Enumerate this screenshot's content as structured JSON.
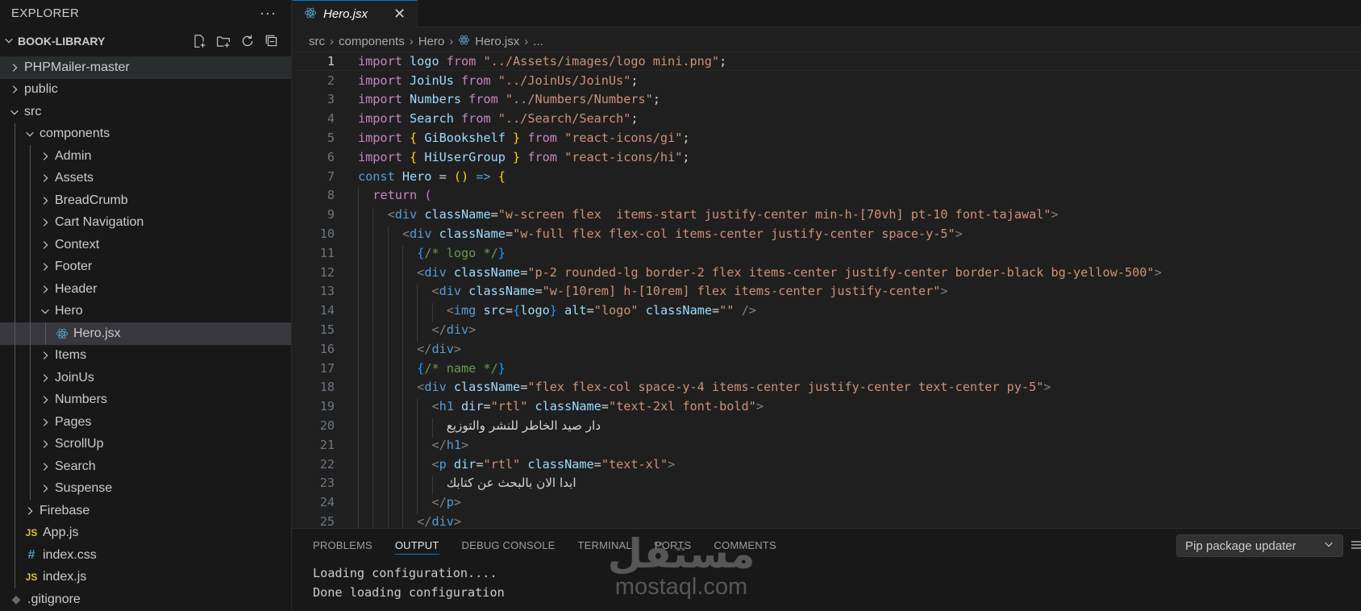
{
  "explorer": {
    "title": "EXPLORER",
    "more": "···",
    "project": "BOOK-LIBRARY",
    "items": [
      {
        "label": "PHPMailer-master",
        "depth": 0,
        "type": "folder",
        "open": false
      },
      {
        "label": "public",
        "depth": 0,
        "type": "folder",
        "open": false
      },
      {
        "label": "src",
        "depth": 0,
        "type": "folder",
        "open": true
      },
      {
        "label": "components",
        "depth": 1,
        "type": "folder",
        "open": true
      },
      {
        "label": "Admin",
        "depth": 2,
        "type": "folder",
        "open": false
      },
      {
        "label": "Assets",
        "depth": 2,
        "type": "folder",
        "open": false
      },
      {
        "label": "BreadCrumb",
        "depth": 2,
        "type": "folder",
        "open": false
      },
      {
        "label": "Cart Navigation",
        "depth": 2,
        "type": "folder",
        "open": false
      },
      {
        "label": "Context",
        "depth": 2,
        "type": "folder",
        "open": false
      },
      {
        "label": "Footer",
        "depth": 2,
        "type": "folder",
        "open": false
      },
      {
        "label": "Header",
        "depth": 2,
        "type": "folder",
        "open": false
      },
      {
        "label": "Hero",
        "depth": 2,
        "type": "folder",
        "open": true
      },
      {
        "label": "Hero.jsx",
        "depth": 3,
        "type": "react",
        "open": false
      },
      {
        "label": "Items",
        "depth": 2,
        "type": "folder",
        "open": false
      },
      {
        "label": "JoinUs",
        "depth": 2,
        "type": "folder",
        "open": false
      },
      {
        "label": "Numbers",
        "depth": 2,
        "type": "folder",
        "open": false
      },
      {
        "label": "Pages",
        "depth": 2,
        "type": "folder",
        "open": false
      },
      {
        "label": "ScrollUp",
        "depth": 2,
        "type": "folder",
        "open": false
      },
      {
        "label": "Search",
        "depth": 2,
        "type": "folder",
        "open": false
      },
      {
        "label": "Suspense",
        "depth": 2,
        "type": "folder",
        "open": false
      },
      {
        "label": "Firebase",
        "depth": 1,
        "type": "folder",
        "open": false
      },
      {
        "label": "App.js",
        "depth": 1,
        "type": "js",
        "open": false
      },
      {
        "label": "index.css",
        "depth": 1,
        "type": "css",
        "open": false
      },
      {
        "label": "index.js",
        "depth": 1,
        "type": "js",
        "open": false
      },
      {
        "label": ".gitignore",
        "depth": 0,
        "type": "git",
        "open": false
      }
    ],
    "hover_index": 0,
    "selected_index": 12,
    "icons": {
      "js": "JS",
      "css": "#",
      "git": "◆"
    }
  },
  "tabs": [
    {
      "label": "Hero.jsx",
      "close": "✕"
    }
  ],
  "breadcrumb": [
    "src",
    "components",
    "Hero",
    "Hero.jsx",
    "..."
  ],
  "editor": {
    "current_line": 1,
    "lines": [
      [
        {
          "t": "import ",
          "c": "k1"
        },
        {
          "t": "logo ",
          "c": "var"
        },
        {
          "t": "from ",
          "c": "k1"
        },
        {
          "t": "\"../Assets/images/logo mini.png\"",
          "c": "str"
        },
        {
          "t": ";",
          "c": "white"
        }
      ],
      [
        {
          "t": "import ",
          "c": "k1"
        },
        {
          "t": "JoinUs ",
          "c": "var"
        },
        {
          "t": "from ",
          "c": "k1"
        },
        {
          "t": "\"../JoinUs/JoinUs\"",
          "c": "str"
        },
        {
          "t": ";",
          "c": "white"
        }
      ],
      [
        {
          "t": "import ",
          "c": "k1"
        },
        {
          "t": "Numbers ",
          "c": "var"
        },
        {
          "t": "from ",
          "c": "k1"
        },
        {
          "t": "\"../Numbers/Numbers\"",
          "c": "str"
        },
        {
          "t": ";",
          "c": "white"
        }
      ],
      [
        {
          "t": "import ",
          "c": "k1"
        },
        {
          "t": "Search ",
          "c": "var"
        },
        {
          "t": "from ",
          "c": "k1"
        },
        {
          "t": "\"../Search/Search\"",
          "c": "str"
        },
        {
          "t": ";",
          "c": "white"
        }
      ],
      [
        {
          "t": "import ",
          "c": "k1"
        },
        {
          "t": "{ ",
          "c": "br1"
        },
        {
          "t": "GiBookshelf ",
          "c": "var"
        },
        {
          "t": "} ",
          "c": "br1"
        },
        {
          "t": "from ",
          "c": "k1"
        },
        {
          "t": "\"react-icons/gi\"",
          "c": "str"
        },
        {
          "t": ";",
          "c": "white"
        }
      ],
      [
        {
          "t": "import ",
          "c": "k1"
        },
        {
          "t": "{ ",
          "c": "br1"
        },
        {
          "t": "HiUserGroup ",
          "c": "var"
        },
        {
          "t": "} ",
          "c": "br1"
        },
        {
          "t": "from ",
          "c": "k1"
        },
        {
          "t": "\"react-icons/hi\"",
          "c": "str"
        },
        {
          "t": ";",
          "c": "white"
        }
      ],
      [
        {
          "t": "const ",
          "c": "k2"
        },
        {
          "t": "Hero ",
          "c": "var"
        },
        {
          "t": "= ",
          "c": "white"
        },
        {
          "t": "() ",
          "c": "br1"
        },
        {
          "t": "=> ",
          "c": "k2"
        },
        {
          "t": "{",
          "c": "br1"
        }
      ],
      [
        {
          "t": "  "
        },
        {
          "t": "return ",
          "c": "k1"
        },
        {
          "t": "(",
          "c": "br2"
        }
      ],
      [
        {
          "t": "    "
        },
        {
          "t": "<",
          "c": "punc"
        },
        {
          "t": "div ",
          "c": "tag"
        },
        {
          "t": "className",
          "c": "attr"
        },
        {
          "t": "=",
          "c": "white"
        },
        {
          "t": "\"w-screen flex  items-start justify-center min-h-[70vh] pt-10 font-tajawal\"",
          "c": "str"
        },
        {
          "t": ">",
          "c": "punc"
        }
      ],
      [
        {
          "t": "      "
        },
        {
          "t": "<",
          "c": "punc"
        },
        {
          "t": "div ",
          "c": "tag"
        },
        {
          "t": "className",
          "c": "attr"
        },
        {
          "t": "=",
          "c": "white"
        },
        {
          "t": "\"w-full flex flex-col items-center justify-center space-y-5\"",
          "c": "str"
        },
        {
          "t": ">",
          "c": "punc"
        }
      ],
      [
        {
          "t": "        "
        },
        {
          "t": "{",
          "c": "br3"
        },
        {
          "t": "/* logo */",
          "c": "com"
        },
        {
          "t": "}",
          "c": "br3"
        }
      ],
      [
        {
          "t": "        "
        },
        {
          "t": "<",
          "c": "punc"
        },
        {
          "t": "div ",
          "c": "tag"
        },
        {
          "t": "className",
          "c": "attr"
        },
        {
          "t": "=",
          "c": "white"
        },
        {
          "t": "\"p-2 rounded-lg border-2 flex items-center justify-center border-black bg-yellow-500\"",
          "c": "str"
        },
        {
          "t": ">",
          "c": "punc"
        }
      ],
      [
        {
          "t": "          "
        },
        {
          "t": "<",
          "c": "punc"
        },
        {
          "t": "div ",
          "c": "tag"
        },
        {
          "t": "className",
          "c": "attr"
        },
        {
          "t": "=",
          "c": "white"
        },
        {
          "t": "\"w-[10rem] h-[10rem] flex items-center justify-center\"",
          "c": "str"
        },
        {
          "t": ">",
          "c": "punc"
        }
      ],
      [
        {
          "t": "            "
        },
        {
          "t": "<",
          "c": "punc"
        },
        {
          "t": "img ",
          "c": "tag"
        },
        {
          "t": "src",
          "c": "attr"
        },
        {
          "t": "=",
          "c": "white"
        },
        {
          "t": "{",
          "c": "br3"
        },
        {
          "t": "logo",
          "c": "var"
        },
        {
          "t": "} ",
          "c": "br3"
        },
        {
          "t": "alt",
          "c": "attr"
        },
        {
          "t": "=",
          "c": "white"
        },
        {
          "t": "\"logo\" ",
          "c": "str"
        },
        {
          "t": "className",
          "c": "attr"
        },
        {
          "t": "=",
          "c": "white"
        },
        {
          "t": "\"\" ",
          "c": "str"
        },
        {
          "t": "/>",
          "c": "punc"
        }
      ],
      [
        {
          "t": "          "
        },
        {
          "t": "</",
          "c": "punc"
        },
        {
          "t": "div",
          "c": "tag"
        },
        {
          "t": ">",
          "c": "punc"
        }
      ],
      [
        {
          "t": "        "
        },
        {
          "t": "</",
          "c": "punc"
        },
        {
          "t": "div",
          "c": "tag"
        },
        {
          "t": ">",
          "c": "punc"
        }
      ],
      [
        {
          "t": "        "
        },
        {
          "t": "{",
          "c": "br3"
        },
        {
          "t": "/* name */",
          "c": "com"
        },
        {
          "t": "}",
          "c": "br3"
        }
      ],
      [
        {
          "t": "        "
        },
        {
          "t": "<",
          "c": "punc"
        },
        {
          "t": "div ",
          "c": "tag"
        },
        {
          "t": "className",
          "c": "attr"
        },
        {
          "t": "=",
          "c": "white"
        },
        {
          "t": "\"flex flex-col space-y-4 items-center justify-center text-center py-5\"",
          "c": "str"
        },
        {
          "t": ">",
          "c": "punc"
        }
      ],
      [
        {
          "t": "          "
        },
        {
          "t": "<",
          "c": "punc"
        },
        {
          "t": "h1 ",
          "c": "tag"
        },
        {
          "t": "dir",
          "c": "attr"
        },
        {
          "t": "=",
          "c": "white"
        },
        {
          "t": "\"rtl\" ",
          "c": "str"
        },
        {
          "t": "className",
          "c": "attr"
        },
        {
          "t": "=",
          "c": "white"
        },
        {
          "t": "\"text-2xl font-bold\"",
          "c": "str"
        },
        {
          "t": ">",
          "c": "punc"
        }
      ],
      [
        {
          "t": "            "
        },
        {
          "t": "دار صيد الخاطر للنشر والتوزيع",
          "c": "arabic"
        }
      ],
      [
        {
          "t": "          "
        },
        {
          "t": "</",
          "c": "punc"
        },
        {
          "t": "h1",
          "c": "tag"
        },
        {
          "t": ">",
          "c": "punc"
        }
      ],
      [
        {
          "t": "          "
        },
        {
          "t": "<",
          "c": "punc"
        },
        {
          "t": "p ",
          "c": "tag"
        },
        {
          "t": "dir",
          "c": "attr"
        },
        {
          "t": "=",
          "c": "white"
        },
        {
          "t": "\"rtl\" ",
          "c": "str"
        },
        {
          "t": "className",
          "c": "attr"
        },
        {
          "t": "=",
          "c": "white"
        },
        {
          "t": "\"text-xl\"",
          "c": "str"
        },
        {
          "t": ">",
          "c": "punc"
        }
      ],
      [
        {
          "t": "            "
        },
        {
          "t": "ابدا الان بالبحث عن كتابك",
          "c": "arabic"
        }
      ],
      [
        {
          "t": "          "
        },
        {
          "t": "</",
          "c": "punc"
        },
        {
          "t": "p",
          "c": "tag"
        },
        {
          "t": ">",
          "c": "punc"
        }
      ],
      [
        {
          "t": "        "
        },
        {
          "t": "</",
          "c": "punc"
        },
        {
          "t": "div",
          "c": "tag"
        },
        {
          "t": ">",
          "c": "punc"
        }
      ]
    ]
  },
  "panel": {
    "tabs": [
      "PROBLEMS",
      "OUTPUT",
      "DEBUG CONSOLE",
      "TERMINAL",
      "PORTS",
      "COMMENTS"
    ],
    "active_tab": "OUTPUT",
    "select_value": "Pip package updater",
    "output_lines": [
      "Loading configuration....",
      "Done loading configuration"
    ]
  },
  "watermark": {
    "arabic": "مستقل",
    "latin": "mostaql.com"
  },
  "colors": {
    "accent": "#0078d4",
    "sidebar_bg": "#181818",
    "editor_bg": "#1f1f1f"
  }
}
